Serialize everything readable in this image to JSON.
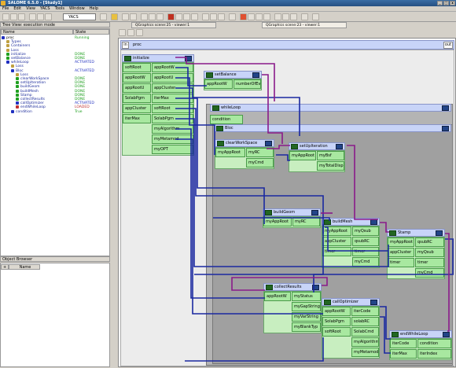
{
  "window": {
    "title": "SALOME 6.5.0 - [Study1]"
  },
  "menu": [
    "File",
    "Edit",
    "View",
    "YACS",
    "Tools",
    "Window",
    "Help"
  ],
  "toolbar": {
    "module": "YACS"
  },
  "tree": {
    "header": "Tree View: execution mode",
    "col_name": "Name",
    "col_state": "State",
    "rows": [
      {
        "label": "proc",
        "state": "Running",
        "indent": 0,
        "color": "#2030c0"
      },
      {
        "label": "Types",
        "state": "",
        "indent": 1,
        "color": "#c0a040"
      },
      {
        "label": "Containers",
        "state": "",
        "indent": 1,
        "color": "#c0a040"
      },
      {
        "label": "Loss",
        "state": "",
        "indent": 1,
        "color": "#c0a040"
      },
      {
        "label": "initialize",
        "state": "DONE",
        "indent": 1,
        "color": "#20a020"
      },
      {
        "label": "setBalance",
        "state": "DONE",
        "indent": 1,
        "color": "#20a020"
      },
      {
        "label": "whileLoop",
        "state": "ACTIVATED",
        "indent": 1,
        "color": "#2030c0"
      },
      {
        "label": "Loss",
        "state": "",
        "indent": 2,
        "color": "#c0a040"
      },
      {
        "label": "Bloc",
        "state": "ACTIVATED",
        "indent": 2,
        "color": "#2030c0"
      },
      {
        "label": "Loss",
        "state": "",
        "indent": 3,
        "color": "#c0a040"
      },
      {
        "label": "clearWorkSpace",
        "state": "DONE",
        "indent": 3,
        "color": "#20a020"
      },
      {
        "label": "setUpIteration",
        "state": "DONE",
        "indent": 3,
        "color": "#20a020"
      },
      {
        "label": "buildGeom",
        "state": "DONE",
        "indent": 3,
        "color": "#20a020"
      },
      {
        "label": "buildMesh",
        "state": "DONE",
        "indent": 3,
        "color": "#20a020"
      },
      {
        "label": "Stamp",
        "state": "DONE",
        "indent": 3,
        "color": "#20a020"
      },
      {
        "label": "collectResults",
        "state": "DONE",
        "indent": 3,
        "color": "#20a020"
      },
      {
        "label": "callOptimizer",
        "state": "ACTIVATED",
        "indent": 3,
        "color": "#2030c0"
      },
      {
        "label": "endWhileLoop",
        "state": "LOADED",
        "indent": 3,
        "color": "#c03030"
      },
      {
        "label": "condition",
        "state": "True",
        "indent": 2,
        "color": "#2030c0"
      }
    ]
  },
  "objbrowser": {
    "header": "Object Browser",
    "col_name": "Name"
  },
  "tabs": [
    "QGraphics scene:25 - viewer:1",
    "QGraphics scene:23 - viewer:1"
  ],
  "scene": {
    "proc": {
      "in": "in",
      "title": "proc",
      "out": "out"
    },
    "initialize": {
      "title": "initialize",
      "ports": [
        "softRoot",
        "appRootW",
        "appRootU",
        "SolabPgm",
        "appCluster",
        "iterMax"
      ],
      "outs": [
        "appRootW",
        "appRootU",
        "appCluster",
        "iterMax",
        "softRoot",
        "SolabPgm",
        "myAlgorithm",
        "myMetamod",
        "myOPT"
      ]
    },
    "setBalance": {
      "title": "setBalance",
      "ports": [
        "appRootW",
        "numberOfEv"
      ]
    },
    "whileLoop": {
      "title": "whileLoop",
      "condition": "condition"
    },
    "bloc": {
      "title": "Bloc"
    },
    "clearWorkSpace": {
      "title": "clearWorkSpace",
      "ports": [
        "myAppRoot",
        "myRC",
        "myCmd"
      ]
    },
    "setUpIteration": {
      "title": "setUpIteration",
      "ports": [
        "myAppRoot",
        "myBsf",
        "myTotalDisp"
      ]
    },
    "buildGeom": {
      "title": "buildGeom",
      "ports": [
        "myAppRoot",
        "myRC"
      ]
    },
    "buildMesh": {
      "title": "buildMesh",
      "ports": [
        "myAppRoot",
        "myQsub",
        "appCluster",
        "qsubRC",
        "timer",
        "myCmd"
      ]
    },
    "stamp": {
      "title": "Stamp",
      "ports": [
        "myAppRoot",
        "qsubRC",
        "appCluster",
        "myQsub",
        "timer",
        "myCmd"
      ]
    },
    "collectResults": {
      "title": "collectResults",
      "ports": [
        "appRootW",
        "myStatus",
        "myGapString",
        "myVarString",
        "myBlankTyp"
      ]
    },
    "callOptimizer": {
      "title": "callOptimizer",
      "ports": [
        "appRootW",
        "iterCode",
        "SolabPgm",
        "solabRC",
        "softRoot",
        "SolabCmd",
        "myAlgorithm",
        "myMetamod"
      ]
    },
    "endWhileLoop": {
      "title": "endWhileLoop",
      "ports": [
        "iterCode",
        "condition",
        "iterMax",
        "iterIndex"
      ]
    }
  }
}
